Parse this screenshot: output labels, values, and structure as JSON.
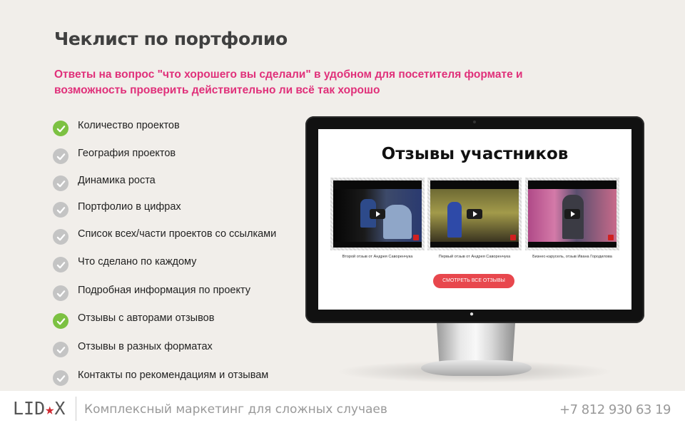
{
  "header": {
    "title": "Чеклист по портфолио",
    "subtitle": "Ответы на вопрос \"что хорошего вы сделали\" в удобном для посетителя формате и возможность проверить действительно ли всё так хорошо"
  },
  "checklist": [
    {
      "label": "Количество проектов",
      "checked": true
    },
    {
      "label": "География проектов",
      "checked": false
    },
    {
      "label": "Динамика роста",
      "checked": false
    },
    {
      "label": "Портфолио в цифрах",
      "checked": false
    },
    {
      "label": "Список всех/части проектов со ссылками",
      "checked": false
    },
    {
      "label": "Что сделано по каждому",
      "checked": false
    },
    {
      "label": "Подробная информация по проекту",
      "checked": false
    },
    {
      "label": "Отзывы с авторами отзывов",
      "checked": true
    },
    {
      "label": "Отзывы в разных форматах",
      "checked": false
    },
    {
      "label": "Контакты по рекомендациям и отзывам",
      "checked": false
    }
  ],
  "screen": {
    "title": "Отзывы участников",
    "videos": [
      {
        "caption": "Второй отзыв от Андрея Саворенчука"
      },
      {
        "caption": "Первый отзыв от Андрея Саворенчука"
      },
      {
        "caption": "Бизнес-карусель, отзыв Ивана Городилова"
      }
    ],
    "button_label": "СМОТРЕТЬ ВСЕ ОТЗЫВЫ"
  },
  "footer": {
    "logo_left": "LID",
    "logo_star": "★",
    "logo_right": "X",
    "tagline": "Комплексный маркетинг для сложных случаев",
    "phone": "+7 812 930 63 19"
  },
  "colors": {
    "accent_pink": "#e0307a",
    "check_done": "#7cc142",
    "check_todo": "#c4c4c4",
    "button_red": "#e8474d"
  }
}
